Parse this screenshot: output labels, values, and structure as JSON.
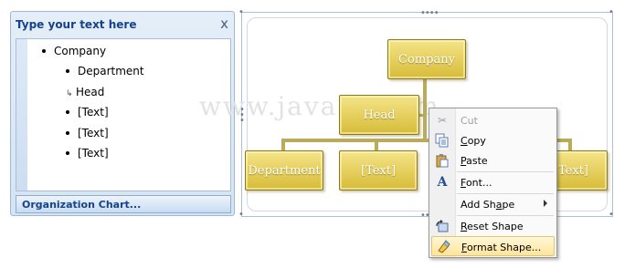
{
  "text_pane": {
    "title": "Type your text here",
    "close_glyph": "x",
    "items": [
      {
        "text": "Company",
        "level": 1,
        "marker": "dot"
      },
      {
        "text": "Department",
        "level": 2,
        "marker": "dot"
      },
      {
        "text": "Head",
        "level": 2,
        "marker": "assistant"
      },
      {
        "text": "[Text]",
        "level": 2,
        "marker": "dot"
      },
      {
        "text": "[Text]",
        "level": 2,
        "marker": "dot"
      },
      {
        "text": "[Text]",
        "level": 2,
        "marker": "dot"
      }
    ],
    "footer_label": "Organization Chart..."
  },
  "diagram": {
    "watermark": "www.java2s.com",
    "shapes": {
      "company": "Company",
      "head": "Head",
      "department": "Department",
      "text_middle": "[Text]",
      "text_right": "[Text]"
    },
    "shape_color": "#e3cc55"
  },
  "context_menu": {
    "cut": {
      "label": "Cut",
      "icon": "scissors-icon",
      "enabled": false
    },
    "copy": {
      "label": "Copy",
      "icon": "copy-icon",
      "enabled": true
    },
    "paste": {
      "label": "Paste",
      "icon": "paste-icon",
      "enabled": true
    },
    "font": {
      "label": "Font...",
      "icon": "font-icon",
      "enabled": true
    },
    "add_shape": {
      "label": "Add Shape",
      "icon": "submenu-arrow-icon",
      "enabled": true
    },
    "reset_shape": {
      "label": "Reset Shape",
      "icon": "reset-shape-icon",
      "enabled": true
    },
    "format_shape": {
      "label": "Format Shape...",
      "icon": "format-shape-icon",
      "enabled": true,
      "highlighted": true
    }
  }
}
